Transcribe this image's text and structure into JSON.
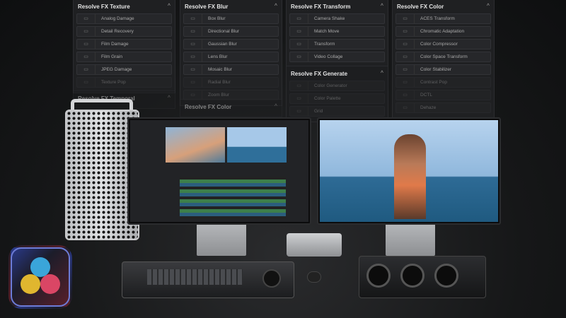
{
  "panels": [
    {
      "title": "Resolve FX Texture",
      "items": [
        "Analog Damage",
        "Detail Recovery",
        "Film Damage",
        "Film Grain",
        "JPEG Damage",
        "Texture Pop"
      ]
    },
    {
      "title": "Resolve FX Blur",
      "items": [
        "Box Blur",
        "Directional Blur",
        "Gaussian Blur",
        "Lens Blur",
        "Mosaic Blur",
        "Radial Blur",
        "Zoom Blur"
      ]
    },
    {
      "title": "Resolve FX Transform",
      "items": [
        "Camera Shake",
        "Match Move",
        "Transform",
        "Video Collage"
      ]
    },
    {
      "title": "Resolve FX Color",
      "items": [
        "ACES Transform",
        "Chromatic Adaptation",
        "Color Compressor",
        "Color Space Transform",
        "Color Stabilizer",
        "Contrast Pop",
        "DCTL",
        "Dehaze"
      ]
    }
  ],
  "sub_panels": [
    {
      "title": "Resolve FX Temporal"
    },
    {
      "title": "Resolve FX Color"
    },
    {
      "title": "Resolve FX Generate",
      "items": [
        "Color Generator",
        "Color Palette",
        "Grid"
      ]
    }
  ],
  "colors": {
    "background": "#141516",
    "panel": "#1f2022",
    "sky": "#9fc3e6",
    "sea": "#2f6f9a"
  }
}
